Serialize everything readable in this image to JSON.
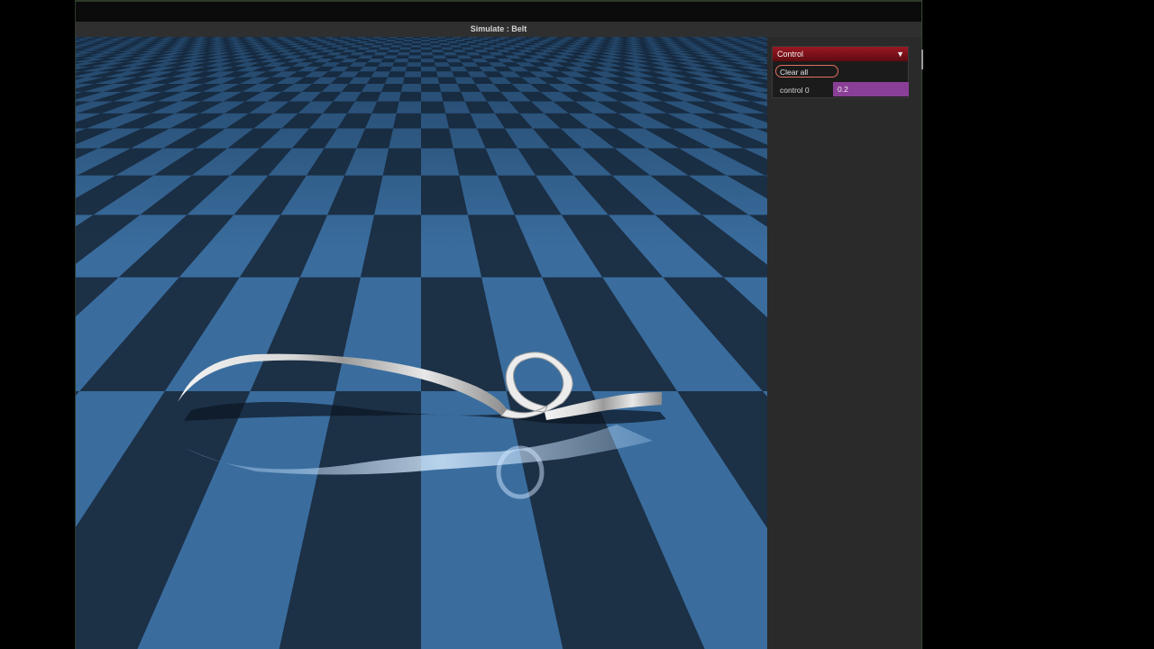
{
  "window": {
    "title": "Simulate : Belt"
  },
  "scene": {
    "floor_colors": [
      "#3a6d9e",
      "#1c3046"
    ],
    "object": "belt-ribbon"
  },
  "control_panel": {
    "header": "Control",
    "collapse_icon": "triangle-down-icon",
    "collapse_glyph": "▼",
    "clear_label": "Clear all",
    "slider_label": "control 0",
    "slider_value": "0.2",
    "accent_color": "#8a3f96",
    "header_color": "#9b1722"
  }
}
